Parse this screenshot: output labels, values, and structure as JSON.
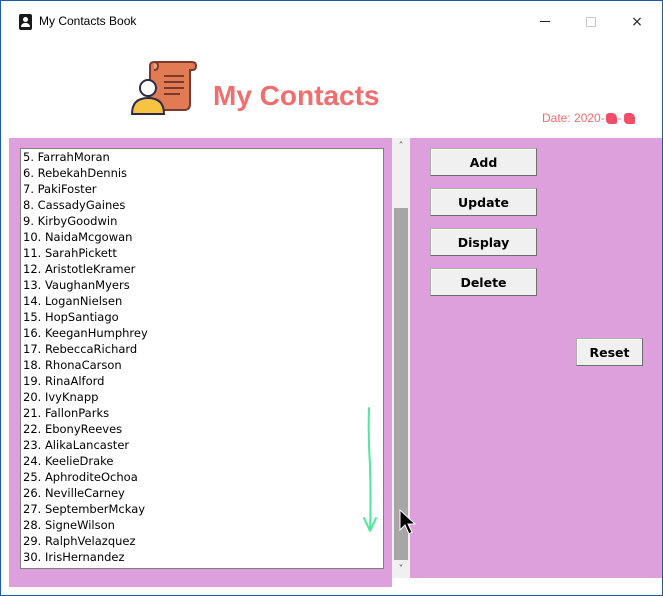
{
  "window": {
    "title": "My Contacts Book",
    "icon": "contacts-book-icon",
    "controls": {
      "minimize": "minimize-icon",
      "maximize": "maximize-icon",
      "close": "×"
    }
  },
  "header": {
    "logo_icon": "contact-scroll-icon",
    "heading": "My Contacts",
    "date_prefix": "Date: 2020-",
    "date_separator": "-"
  },
  "contacts": [
    "5. FarrahMoran",
    "6. RebekahDennis",
    "7. PakiFoster",
    "8. CassadyGaines",
    "9. KirbyGoodwin",
    "10. NaidaMcgowan",
    "11. SarahPickett",
    "12. AristotleKramer",
    "13. VaughanMyers",
    "14. LoganNielsen",
    "15. HopSantiago",
    "16. KeeganHumphrey",
    "17. RebeccaRichard",
    "18. RhonaCarson",
    "19. RinaAlford",
    "20. IvyKnapp",
    "21. FallonParks",
    "22. EbonyReeves",
    "23. AlikaLancaster",
    "24. KeelieDrake",
    "25. AphroditeOchoa",
    "26. NevilleCarney",
    "27. SeptemberMckay",
    "28. SigneWilson",
    "29. RalphVelazquez",
    "30. IrisHernandez"
  ],
  "scrollbar": {
    "up_arrow": "˄",
    "down_arrow": "˅"
  },
  "buttons": {
    "add": "Add",
    "update": "Update",
    "display": "Display",
    "delete": "Delete",
    "reset": "Reset"
  },
  "colors": {
    "panel_bg": "#dda0dd",
    "heading": "#f26d6d",
    "annotation_arrow": "#4ee89a"
  }
}
